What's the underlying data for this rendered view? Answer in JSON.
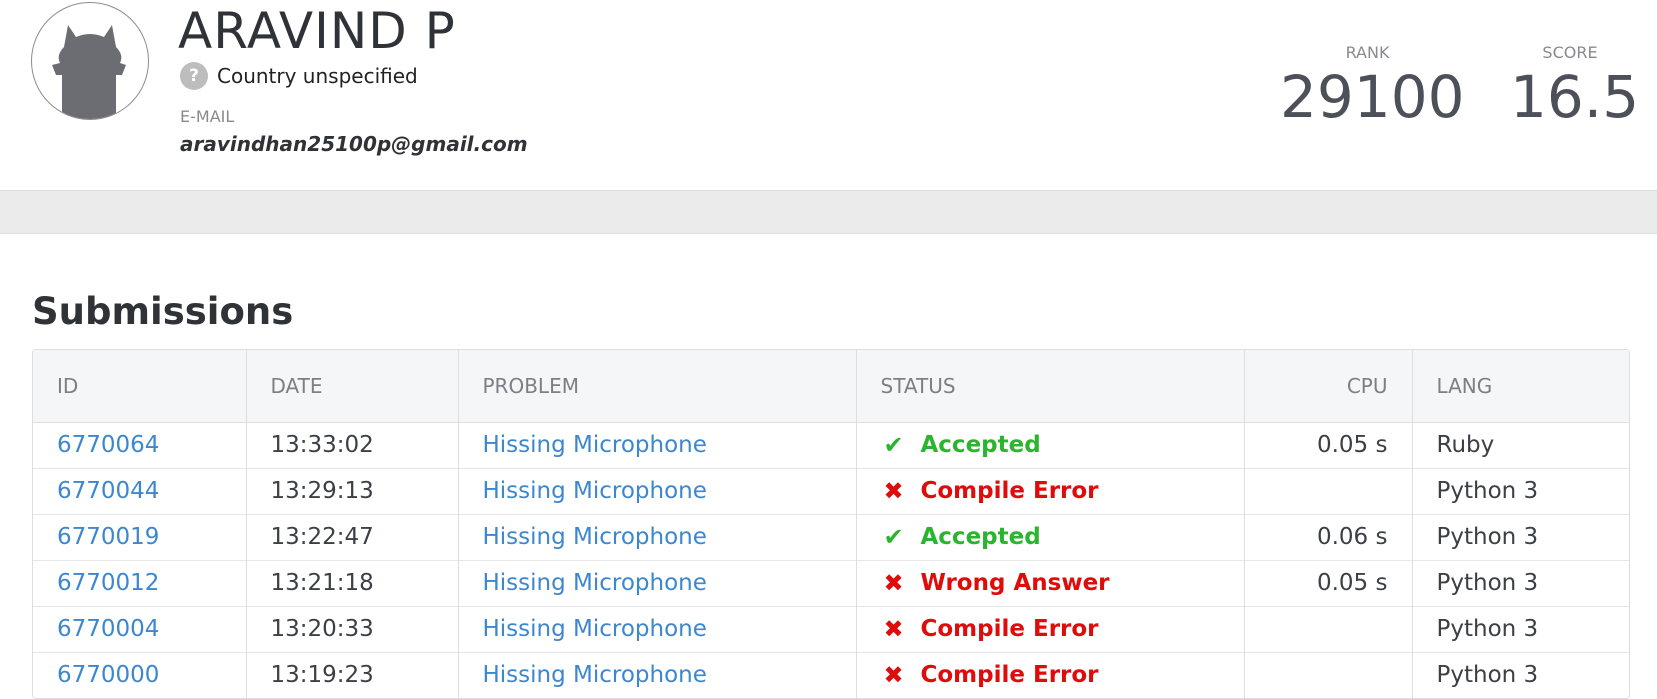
{
  "profile": {
    "name": "ARAVIND P",
    "country_icon": "question-mark",
    "country": "Country unspecified",
    "email_label": "E-MAIL",
    "email": "aravindhan25100p@gmail.com",
    "avatar_icon": "cat-silhouette"
  },
  "stats": {
    "rank_label": "RANK",
    "rank": "29100",
    "score_label": "SCORE",
    "score": "16.5"
  },
  "submissions": {
    "title": "Submissions",
    "columns": [
      "ID",
      "DATE",
      "PROBLEM",
      "STATUS",
      "CPU",
      "LANG"
    ],
    "rows": [
      {
        "id": "6770064",
        "date": "13:33:02",
        "problem": "Hissing Microphone",
        "status": "Accepted",
        "ok": true,
        "cpu": "0.05 s",
        "lang": "Ruby"
      },
      {
        "id": "6770044",
        "date": "13:29:13",
        "problem": "Hissing Microphone",
        "status": "Compile Error",
        "ok": false,
        "cpu": "",
        "lang": "Python 3"
      },
      {
        "id": "6770019",
        "date": "13:22:47",
        "problem": "Hissing Microphone",
        "status": "Accepted",
        "ok": true,
        "cpu": "0.06 s",
        "lang": "Python 3"
      },
      {
        "id": "6770012",
        "date": "13:21:18",
        "problem": "Hissing Microphone",
        "status": "Wrong Answer",
        "ok": false,
        "cpu": "0.05 s",
        "lang": "Python 3"
      },
      {
        "id": "6770004",
        "date": "13:20:33",
        "problem": "Hissing Microphone",
        "status": "Compile Error",
        "ok": false,
        "cpu": "",
        "lang": "Python 3"
      },
      {
        "id": "6770000",
        "date": "13:19:23",
        "problem": "Hissing Microphone",
        "status": "Compile Error",
        "ok": false,
        "cpu": "",
        "lang": "Python 3"
      }
    ]
  },
  "colors": {
    "accepted": "#2bb52f",
    "error": "#e00c0c",
    "link": "#3d87cf"
  }
}
